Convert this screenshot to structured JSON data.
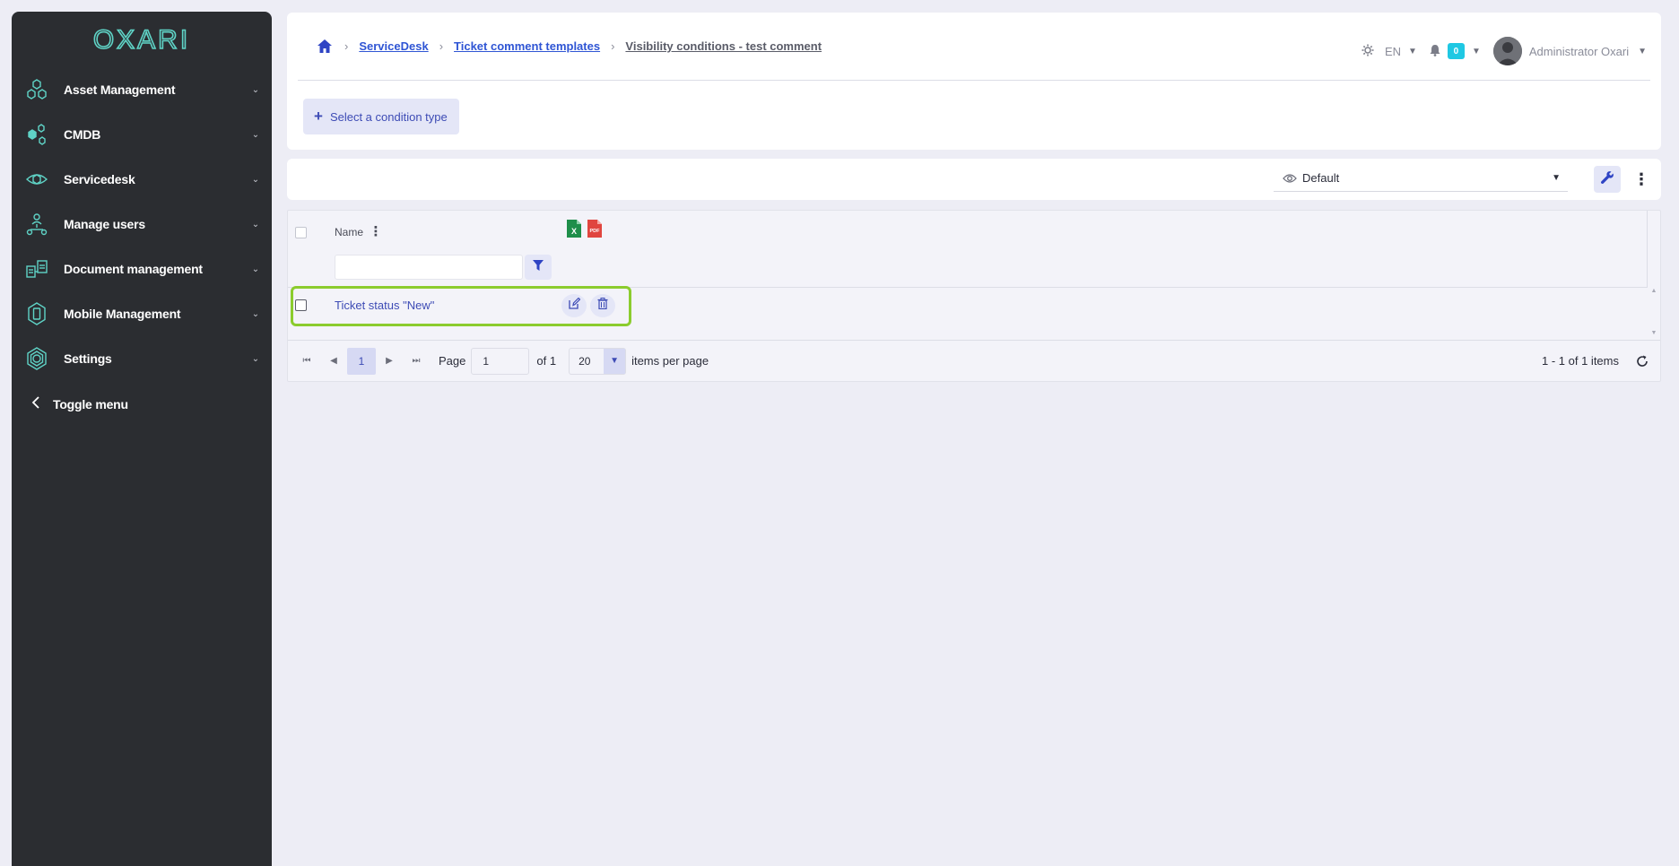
{
  "brand": {
    "logo_text": "OXARI",
    "accent": "#5fd3c6"
  },
  "sidebar": {
    "items": [
      {
        "label": "Asset Management",
        "icon": "hexagons-icon"
      },
      {
        "label": "CMDB",
        "icon": "cmdb-nodes-icon"
      },
      {
        "label": "Servicedesk",
        "icon": "eye-hexagon-icon"
      },
      {
        "label": "Manage users",
        "icon": "users-network-icon"
      },
      {
        "label": "Document management",
        "icon": "documents-icon"
      },
      {
        "label": "Mobile Management",
        "icon": "mobile-hexagon-icon"
      },
      {
        "label": "Settings",
        "icon": "settings-hexagon-icon"
      }
    ],
    "toggle_label": "Toggle menu"
  },
  "breadcrumb": {
    "items": [
      "ServiceDesk",
      "Ticket comment templates"
    ],
    "current": "Visibility conditions - test comment"
  },
  "header": {
    "language": "EN",
    "notifications_count": "0",
    "user_name": "Administrator Oxari"
  },
  "actions": {
    "select_condition": "Select a condition type"
  },
  "view": {
    "selected": "Default"
  },
  "grid": {
    "columns": [
      "Name"
    ],
    "rows": [
      {
        "name": "Ticket status \"New\""
      }
    ],
    "filter_value": ""
  },
  "pager": {
    "current_page": "1",
    "page_label": "Page",
    "page_input": "1",
    "of_label": "of 1",
    "page_size": "20",
    "per_page_label": "items per page",
    "count_label": "1 - 1 of 1 items"
  },
  "colors": {
    "sidebar_bg": "#2b2d31",
    "link": "#2f55d4",
    "highlight": "#8bcc2e",
    "badge": "#1fc8e3",
    "excel": "#1e8e4a",
    "pdf": "#e0453f"
  }
}
